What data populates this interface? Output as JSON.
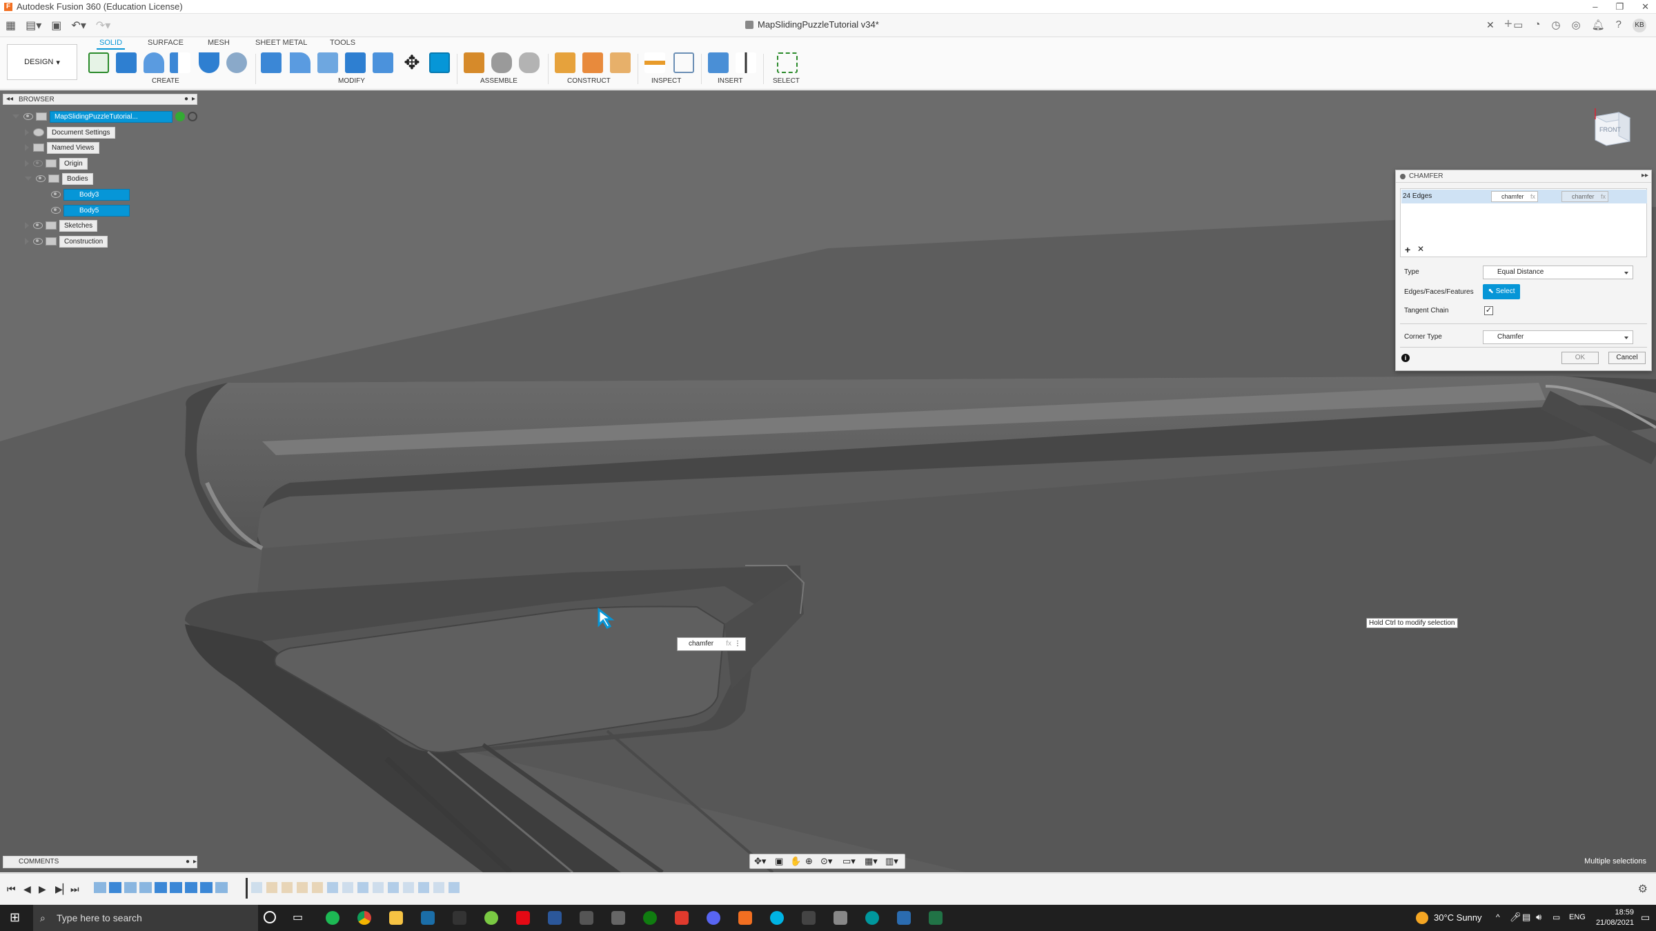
{
  "window": {
    "title": "Autodesk Fusion 360 (Education License)",
    "app_icon": "F"
  },
  "document_tab": {
    "title": "MapSlidingPuzzleTutorial v34*"
  },
  "user": {
    "initials": "KB"
  },
  "toolbar": {
    "workspace": "DESIGN",
    "tabs": [
      "SOLID",
      "SURFACE",
      "MESH",
      "SHEET METAL",
      "TOOLS"
    ],
    "groups": [
      "CREATE",
      "MODIFY",
      "ASSEMBLE",
      "CONSTRUCT",
      "INSPECT",
      "INSERT",
      "SELECT"
    ]
  },
  "browser": {
    "title": "BROWSER",
    "root": "MapSlidingPuzzleTutorial...",
    "items": [
      {
        "label": "Document Settings"
      },
      {
        "label": "Named Views"
      },
      {
        "label": "Origin"
      },
      {
        "label": "Bodies"
      },
      {
        "label": "Body3"
      },
      {
        "label": "Body5"
      },
      {
        "label": "Sketches"
      },
      {
        "label": "Construction"
      }
    ]
  },
  "chamfer": {
    "title": "CHAMFER",
    "selection_count": "24 Edges",
    "distance_value": "chamfer",
    "distance_value2": "chamfer",
    "fx": "fx",
    "type_label": "Type",
    "type_value": "Equal Distance",
    "edges_label": "Edges/Faces/Features",
    "select_button": "Select",
    "tangent_label": "Tangent Chain",
    "tangent_checked": true,
    "corner_label": "Corner Type",
    "corner_value": "Chamfer",
    "ok": "OK",
    "cancel": "Cancel"
  },
  "viewcube": {
    "face": "FRONT"
  },
  "viewport": {
    "hint": "Hold Ctrl to modify selection",
    "inline_value": "chamfer",
    "status": "Multiple selections"
  },
  "comments": {
    "title": "COMMENTS"
  },
  "taskbar": {
    "search_placeholder": "Type here to search",
    "weather": "30°C  Sunny",
    "lang": "ENG",
    "time": "18:59",
    "date": "21/08/2021"
  },
  "colors": {
    "accent": "#0696d7",
    "viewport_bg": "#5c5c5c"
  }
}
